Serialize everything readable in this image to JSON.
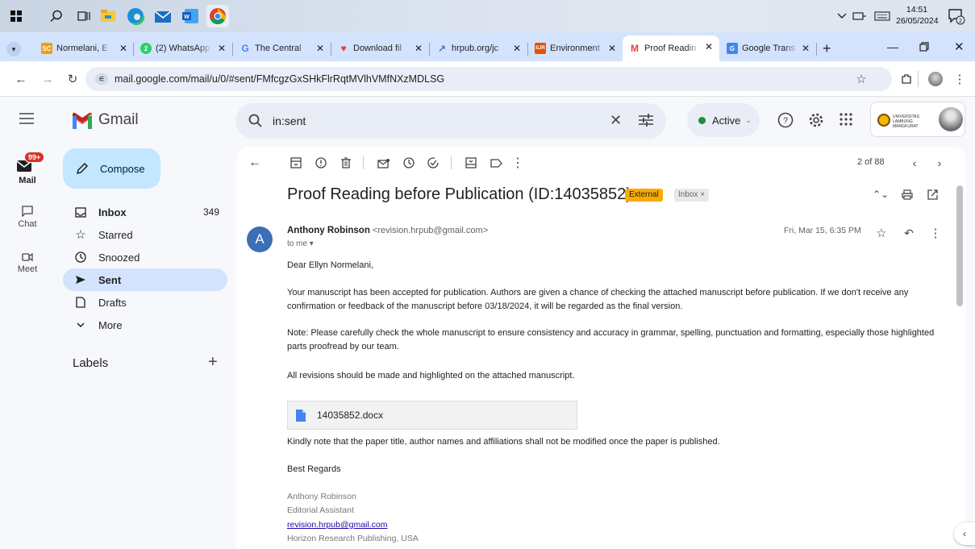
{
  "taskbar": {
    "time": "14:51",
    "date": "26/05/2024",
    "notification_count": "2"
  },
  "tabs": [
    {
      "title": "Normelani, E",
      "fav": "SC",
      "color": "#f39c12"
    },
    {
      "title": "(2) WhatsApp",
      "fav": "2",
      "color": "#25d366"
    },
    {
      "title": "The Central",
      "fav": "G",
      "color": "#4285f4"
    },
    {
      "title": "Download fil",
      "fav": "♥",
      "color": "#e53935"
    },
    {
      "title": "hrpub.org/jc",
      "fav": "↗",
      "color": "#5c6bc0"
    },
    {
      "title": "Environment",
      "fav": "SJR",
      "color": "#e65100"
    },
    {
      "title": "Proof Readin",
      "fav": "M",
      "color": "#ea4335"
    },
    {
      "title": "Google Trans",
      "fav": "G",
      "color": "#4285f4"
    }
  ],
  "browser": {
    "url": "mail.google.com/mail/u/0/#sent/FMfcgzGxSHkFlrRqtMVlhVMfNXzMDLSG"
  },
  "gmail": {
    "logo_text": "Gmail",
    "search_query": "in:sent",
    "status": "Active",
    "univ_logo_text": "UNIVERSITAS LAMBUNG MANGKURAT"
  },
  "rail": {
    "mail_badge": "99+",
    "mail": "Mail",
    "chat": "Chat",
    "meet": "Meet"
  },
  "nav": {
    "compose": "Compose",
    "items": [
      {
        "label": "Inbox",
        "count": "349"
      },
      {
        "label": "Starred",
        "count": ""
      },
      {
        "label": "Snoozed",
        "count": ""
      },
      {
        "label": "Sent",
        "count": ""
      },
      {
        "label": "Drafts",
        "count": ""
      },
      {
        "label": "More",
        "count": ""
      }
    ],
    "labels_heading": "Labels",
    "labels_add": "+"
  },
  "email": {
    "pagination": "2 of 88",
    "subject": "Proof Reading before Publication (ID:14035852)",
    "badge_external": "External",
    "badge_inbox": "Inbox ×",
    "sender_name": "Anthony Robinson",
    "sender_email": "<revision.hrpub@gmail.com>",
    "to": "to me ▾",
    "date": "Fri, Mar 15, 6:35 PM",
    "avatar_letter": "A",
    "greeting": "Dear Ellyn Normelani,",
    "para1": "Your manuscript has been accepted for publication. Authors are given a chance of checking the attached manuscript before publication. If we don't receive any confirmation or feedback of the manuscript before 03/18/2024, it will be regarded as the final version.",
    "para2": "Note: Please carefully check the whole manuscript to ensure consistency and accuracy in grammar, spelling, punctuation and formatting, especially those highlighted parts proofread by our team.",
    "para3": "All revisions should be made and highlighted on the attached manuscript.",
    "attachment": "14035852.docx",
    "para4": "Kindly note that the paper title, author names and affiliations shall not be modified once the paper is published.",
    "closing": "Best Regards",
    "sig_name": "Anthony Robinson",
    "sig_title": "Editorial Assistant",
    "sig_email": "revision.hrpub@gmail.com",
    "sig_company": "Horizon Research Publishing, USA"
  }
}
